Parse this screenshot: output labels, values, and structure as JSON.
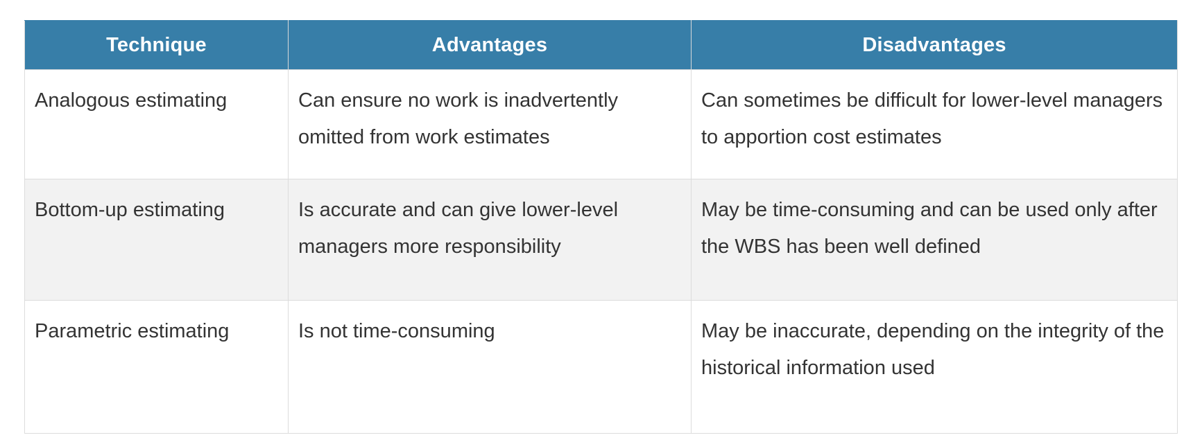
{
  "table": {
    "headers": [
      "Technique",
      "Advantages",
      "Disadvantages"
    ],
    "rows": [
      {
        "technique": "Analogous estimating",
        "advantages": "Can ensure no work is inadvertently omitted from work estimates",
        "disadvantages": "Can sometimes be difficult for lower-level managers to apportion cost estimates"
      },
      {
        "technique": "Bottom-up estimating",
        "advantages": "Is accurate and can give lower-level managers more responsibility",
        "disadvantages": "May be time-consuming and can be used only after the WBS has been well defined"
      },
      {
        "technique": "Parametric estimating",
        "advantages": "Is not time-consuming",
        "disadvantages": "May be inaccurate, depending on the integrity of the historical information used"
      }
    ]
  },
  "colors": {
    "header_bg": "#377ea8",
    "header_text": "#ffffff",
    "alt_row_bg": "#f2f2f2",
    "border": "#dcdcdc"
  }
}
